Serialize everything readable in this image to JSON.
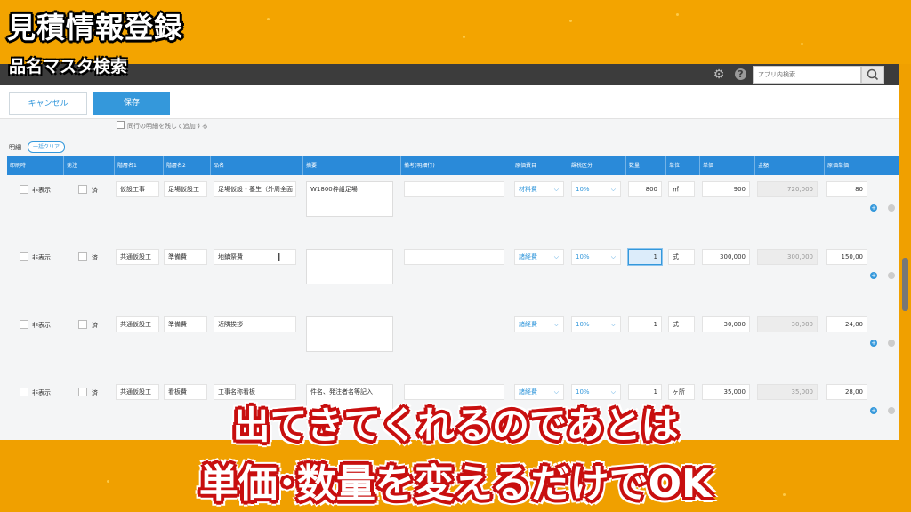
{
  "overlay": {
    "title": "見積情報登録",
    "subtitle": "品名マスタ検索",
    "caption_line1": "出てきてくれるのであとは",
    "caption_line2": "単価･数量を変えるだけでOK"
  },
  "topbar": {
    "settings_icon": "gear-icon",
    "help_label": "?",
    "search_placeholder": "アプリ内検索",
    "search_icon": "search-icon"
  },
  "toolbar": {
    "cancel_label": "キャンセル",
    "save_label": "保存"
  },
  "partial_label": "同行の明細を残して追加する",
  "details": {
    "section_label": "明細",
    "clear_all_label": "一括クリア"
  },
  "columns": [
    "印刷時",
    "発注",
    "階層名1",
    "階層名2",
    "品名",
    "摘要",
    "備考(明細行)",
    "原価費目",
    "課税区分",
    "数量",
    "単位",
    "単価",
    "金額",
    "原価単価"
  ],
  "rows": [
    {
      "hide": "非表示",
      "ordered": "済",
      "level1": "仮設工事",
      "level2": "足場仮設工",
      "item": "足場仮設・養生（外周全面",
      "note": "W1800枠組足場",
      "remark": "",
      "cost_item": "材料費",
      "tax": "10%",
      "qty": "800",
      "unit": "㎡",
      "unit_price": "900",
      "amount": "720,000",
      "cost_price": "80"
    },
    {
      "hide": "非表示",
      "ordered": "済",
      "level1": "共通仮設工",
      "level2": "準備費",
      "item": "地鎮祭費",
      "note": "",
      "remark": "",
      "cost_item": "諸経費",
      "tax": "10%",
      "qty": "1",
      "unit": "式",
      "unit_price": "300,000",
      "amount": "300,000",
      "cost_price": "150,00"
    },
    {
      "hide": "非表示",
      "ordered": "済",
      "level1": "共通仮設工",
      "level2": "準備費",
      "item": "近隣挨拶",
      "note": "",
      "remark": "",
      "cost_item": "諸経費",
      "tax": "10%",
      "qty": "1",
      "unit": "式",
      "unit_price": "30,000",
      "amount": "30,000",
      "cost_price": "24,00"
    },
    {
      "hide": "非表示",
      "ordered": "済",
      "level1": "共通仮設工",
      "level2": "看板費",
      "item": "工事名称看板",
      "note": "件名、発注者名等記入",
      "remark": "",
      "cost_item": "諸経費",
      "tax": "10%",
      "qty": "1",
      "unit": "ヶ所",
      "unit_price": "35,000",
      "amount": "35,000",
      "cost_price": "28,00"
    }
  ]
}
